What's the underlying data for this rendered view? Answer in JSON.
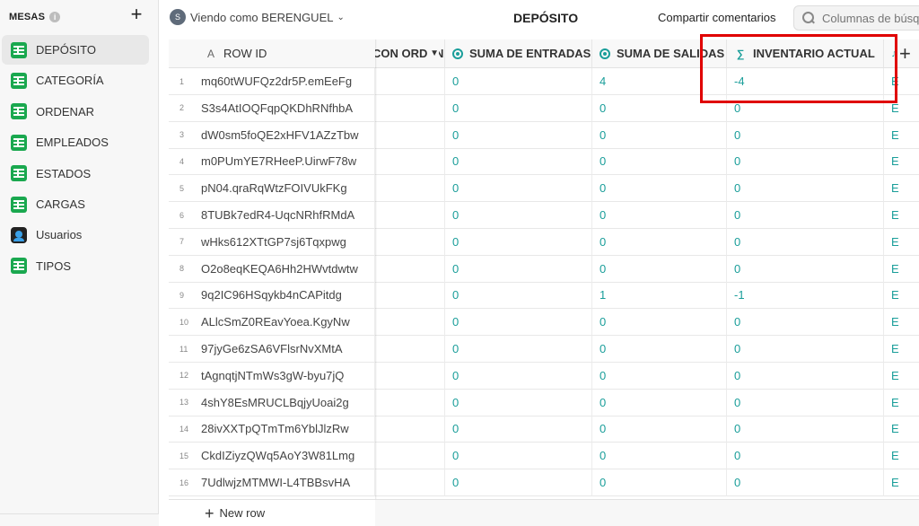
{
  "sidebar": {
    "title": "MESAS",
    "info_icon": "i",
    "items": [
      {
        "label": "DEPÓSITO",
        "icon": "table-icon",
        "active": true
      },
      {
        "label": "CATEGORÍA",
        "icon": "table-icon"
      },
      {
        "label": "ORDENAR",
        "icon": "table-icon"
      },
      {
        "label": "EMPLEADOS",
        "icon": "table-icon"
      },
      {
        "label": "ESTADOS",
        "icon": "table-icon"
      },
      {
        "label": "CARGAS",
        "icon": "table-icon"
      },
      {
        "label": "Usuarios",
        "icon": "users-icon"
      },
      {
        "label": "TIPOS",
        "icon": "table-icon"
      }
    ]
  },
  "topbar": {
    "avatar_initial": "S",
    "viewer_prefix": "Viendo como",
    "viewer_name": "BERENGUEL",
    "title": "DEPÓSITO",
    "share_label": "Compartir comentarios",
    "search_placeholder": "Columnas de búsqueda"
  },
  "table": {
    "columns": {
      "rowid": "ROW ID",
      "rowid_icon": "A",
      "partial": "CON ORDEN",
      "entradas": "SUMA DE ENTRADAS",
      "salidas": "SUMA DE SALIDAS",
      "inventario": "INVENTARIO ACTUAL",
      "next_partial": "E"
    },
    "rows": [
      {
        "n": "1",
        "id": "mq60tWUFQz2dr5P.emEeFg",
        "entradas": "0",
        "salidas": "4",
        "inventario": "-4",
        "next": "E"
      },
      {
        "n": "2",
        "id": "S3s4AtIOQFqpQKDhRNfhbA",
        "entradas": "0",
        "salidas": "0",
        "inventario": "0",
        "next": "E"
      },
      {
        "n": "3",
        "id": "dW0sm5foQE2xHFV1AZzTbw",
        "entradas": "0",
        "salidas": "0",
        "inventario": "0",
        "next": "E"
      },
      {
        "n": "4",
        "id": "m0PUmYE7RHeeP.UirwF78w",
        "entradas": "0",
        "salidas": "0",
        "inventario": "0",
        "next": "E"
      },
      {
        "n": "5",
        "id": "pN04.qraRqWtzFOIVUkFKg",
        "entradas": "0",
        "salidas": "0",
        "inventario": "0",
        "next": "E"
      },
      {
        "n": "6",
        "id": "8TUBk7edR4-UqcNRhfRMdA",
        "entradas": "0",
        "salidas": "0",
        "inventario": "0",
        "next": "E"
      },
      {
        "n": "7",
        "id": "wHks612XTtGP7sj6Tqxpwg",
        "entradas": "0",
        "salidas": "0",
        "inventario": "0",
        "next": "E"
      },
      {
        "n": "8",
        "id": "O2o8eqKEQA6Hh2HWvtdwtw",
        "entradas": "0",
        "salidas": "0",
        "inventario": "0",
        "next": "E"
      },
      {
        "n": "9",
        "id": "9q2IC96HSqykb4nCAPitdg",
        "entradas": "0",
        "salidas": "1",
        "inventario": "-1",
        "next": "E"
      },
      {
        "n": "10",
        "id": "ALlcSmZ0REavYoea.KgyNw",
        "entradas": "0",
        "salidas": "0",
        "inventario": "0",
        "next": "E"
      },
      {
        "n": "11",
        "id": "97jyGe6zSA6VFlsrNvXMtA",
        "entradas": "0",
        "salidas": "0",
        "inventario": "0",
        "next": "E"
      },
      {
        "n": "12",
        "id": "tAgnqtjNTmWs3gW-byu7jQ",
        "entradas": "0",
        "salidas": "0",
        "inventario": "0",
        "next": "E"
      },
      {
        "n": "13",
        "id": "4shY8EsMRUCLBqjyUoai2g",
        "entradas": "0",
        "salidas": "0",
        "inventario": "0",
        "next": "E"
      },
      {
        "n": "14",
        "id": "28ivXXTpQTmTm6YblJlzRw",
        "entradas": "0",
        "salidas": "0",
        "inventario": "0",
        "next": "E"
      },
      {
        "n": "15",
        "id": "CkdIZiyzQWq5AoY3W81Lmg",
        "entradas": "0",
        "salidas": "0",
        "inventario": "0",
        "next": "E"
      },
      {
        "n": "16",
        "id": "7UdlwjzMTMWI-L4TBBsvHA",
        "entradas": "0",
        "salidas": "0",
        "inventario": "0",
        "next": "E"
      }
    ],
    "new_row_label": "New row"
  },
  "colors": {
    "accent_teal": "#1a9e9a",
    "table_icon_green": "#1aa84f",
    "highlight_red": "#e00000"
  }
}
